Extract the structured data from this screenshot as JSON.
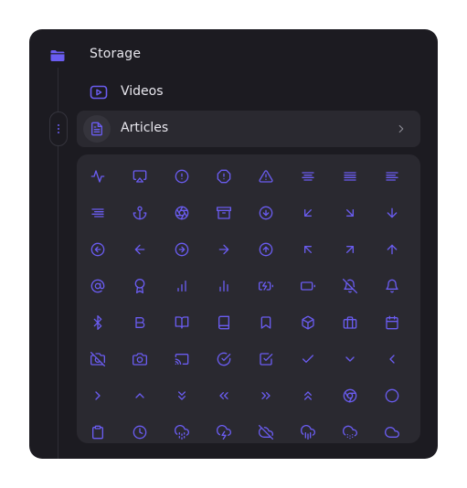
{
  "sidebar": {
    "storage_label": "Storage",
    "items": [
      {
        "label": "Videos",
        "icon": "video-icon"
      },
      {
        "label": "Articles",
        "icon": "document-icon",
        "selected": true
      }
    ]
  },
  "colors": {
    "panel_bg": "#1c1b21",
    "row_bg": "#2a2930",
    "accent": "#6a5cf0",
    "text": "#e8e7ee"
  },
  "icon_grid": {
    "icons": [
      "activity",
      "airplay",
      "alert-circle",
      "alert-octagon",
      "alert-triangle",
      "align-center",
      "align-justify",
      "align-left",
      "align-right",
      "anchor",
      "aperture",
      "archive",
      "arrow-down-circle",
      "arrow-down-left",
      "arrow-down-right",
      "arrow-down",
      "arrow-left-circle",
      "arrow-left",
      "arrow-right-circle",
      "arrow-right",
      "arrow-up-circle",
      "arrow-up-left",
      "arrow-up-right",
      "arrow-up",
      "at-sign",
      "award",
      "bar-chart",
      "bar-chart-2",
      "battery-charging",
      "battery",
      "bell-off",
      "bell",
      "bluetooth",
      "bold",
      "book-open",
      "book",
      "bookmark",
      "box",
      "briefcase",
      "calendar",
      "camera-off",
      "camera",
      "cast",
      "check-circle",
      "check-square",
      "check",
      "chevron-down",
      "chevron-left",
      "chevron-right",
      "chevron-up",
      "chevrons-down",
      "chevrons-left",
      "chevrons-right",
      "chevrons-up",
      "chrome",
      "circle",
      "clipboard",
      "clock",
      "cloud-drizzle",
      "cloud-lightning",
      "cloud-off",
      "cloud-rain",
      "cloud-snow",
      "cloud"
    ]
  }
}
